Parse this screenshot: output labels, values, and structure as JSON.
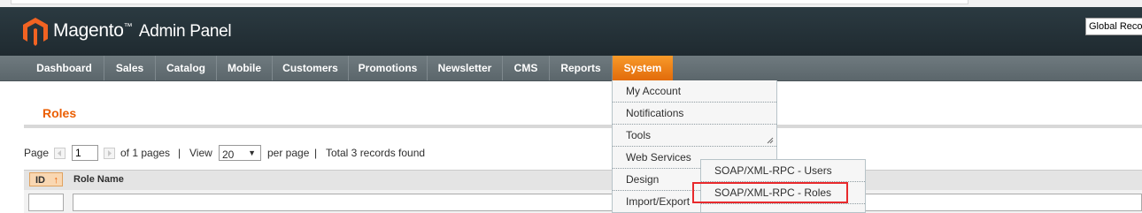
{
  "header": {
    "brand": "Magento",
    "brand_tm": "™",
    "brand_suffix": "Admin Panel",
    "scope_select": "Global Record Search"
  },
  "nav": {
    "items": [
      {
        "label": "Dashboard"
      },
      {
        "label": "Sales"
      },
      {
        "label": "Catalog"
      },
      {
        "label": "Mobile"
      },
      {
        "label": "Customers"
      },
      {
        "label": "Promotions"
      },
      {
        "label": "Newsletter"
      },
      {
        "label": "CMS"
      },
      {
        "label": "Reports"
      },
      {
        "label": "System",
        "active": true
      }
    ],
    "active_color": "#eb6c0b"
  },
  "page": {
    "title": "Roles",
    "title_color": "#eb5e00"
  },
  "pager": {
    "page_label": "Page",
    "page_value": "1",
    "of_pages": "of 1 pages",
    "sep1": "|",
    "view_label": "View",
    "view_value": "20",
    "per_page": "per page",
    "sep2": "|",
    "total": "Total 3 records found"
  },
  "grid": {
    "columns": [
      "ID",
      "Role Name"
    ],
    "sort_icon": "arrow-up-icon"
  },
  "system_menu": {
    "items": [
      {
        "label": "My Account"
      },
      {
        "label": "Notifications"
      },
      {
        "label": "Tools"
      },
      {
        "label": "Web Services"
      },
      {
        "label": "Design"
      },
      {
        "label": "Import/Export"
      }
    ]
  },
  "web_services_submenu": {
    "items": [
      {
        "label": "SOAP/XML-RPC - Users"
      },
      {
        "label": "SOAP/XML-RPC - Roles",
        "highlighted": true
      }
    ],
    "highlight_color": "#e8292c"
  }
}
